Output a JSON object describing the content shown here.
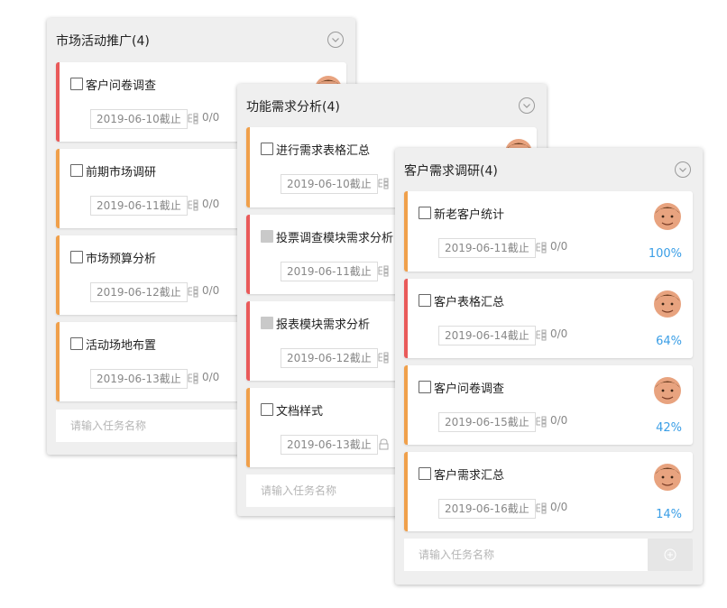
{
  "boards": [
    {
      "title": "市场活动推广(4)",
      "cards": [
        {
          "name": "客户问卷调查",
          "due": "2019-06-10截止",
          "subtasks": "0/0",
          "accent": "red",
          "done": false
        },
        {
          "name": "前期市场调研",
          "due": "2019-06-11截止",
          "subtasks": "0/0",
          "accent": "orange",
          "done": false
        },
        {
          "name": "市场预算分析",
          "due": "2019-06-12截止",
          "subtasks": "0/0",
          "accent": "orange",
          "done": false
        },
        {
          "name": "活动场地布置",
          "due": "2019-06-13截止",
          "subtasks": "0/0",
          "accent": "orange",
          "done": false
        }
      ],
      "input_placeholder": "请输入任务名称"
    },
    {
      "title": "功能需求分析(4)",
      "cards": [
        {
          "name": "进行需求表格汇总",
          "due": "2019-06-10截止",
          "accent": "orange",
          "done": false
        },
        {
          "name": "投票调查模块需求分析",
          "due": "2019-06-11截止",
          "accent": "red",
          "done": true
        },
        {
          "name": "报表模块需求分析",
          "due": "2019-06-12截止",
          "accent": "red",
          "done": true
        },
        {
          "name": "文档样式",
          "due": "2019-06-13截止",
          "accent": "orange",
          "done": false
        }
      ],
      "input_placeholder": "请输入任务名称"
    },
    {
      "title": "客户需求调研(4)",
      "cards": [
        {
          "name": "新老客户统计",
          "due": "2019-06-11截止",
          "subtasks": "0/0",
          "progress": "100%",
          "accent": "orange",
          "done": false
        },
        {
          "name": "客户表格汇总",
          "due": "2019-06-14截止",
          "subtasks": "0/0",
          "progress": "64%",
          "accent": "red",
          "done": false
        },
        {
          "name": "客户问卷调查",
          "due": "2019-06-15截止",
          "subtasks": "0/0",
          "progress": "42%",
          "accent": "orange",
          "done": false
        },
        {
          "name": "客户需求汇总",
          "due": "2019-06-16截止",
          "subtasks": "0/0",
          "progress": "14%",
          "accent": "orange",
          "done": false
        }
      ],
      "input_placeholder": "请输入任务名称"
    }
  ],
  "colors": {
    "accent_orange": "#f0a04b",
    "accent_red": "#e95a5a",
    "progress_blue": "#3a9ee6",
    "board_bg": "#efefef"
  },
  "icons": {
    "collapse": "chevron-down-circle-icon",
    "subtask": "subtask-icon",
    "lock": "lock-icon",
    "add": "plus-circle-icon",
    "avatar": "avatar"
  }
}
